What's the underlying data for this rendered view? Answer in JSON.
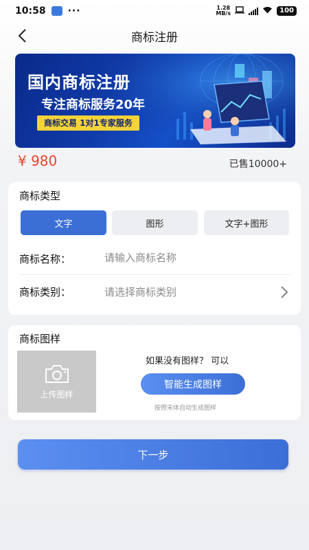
{
  "status_bar": {
    "time": "10:58",
    "more": "···",
    "net_speed_value": "1.28",
    "net_speed_unit": "MB/s",
    "battery": "100"
  },
  "nav": {
    "title": "商标注册"
  },
  "banner": {
    "title": "国内商标注册",
    "subtitle": "专注商标服务20年",
    "tag": "商标交易  1对1专家服务"
  },
  "price": {
    "amount": "¥ 980",
    "sold": "已售10000+"
  },
  "trademark_type": {
    "title": "商标类型",
    "options": [
      "文字",
      "图形",
      "文字+图形"
    ],
    "selected": "文字"
  },
  "form": {
    "name_label": "商标名称：",
    "name_placeholder": "请输入商标名称",
    "category_label": "商标类别：",
    "category_placeholder": "请选择商标类别"
  },
  "design": {
    "title": "商标图样",
    "upload_label": "上传图样",
    "hint": "如果没有图样？ 可以",
    "generate_label": "智能生成图样",
    "note": "按照宋体自动生成图样"
  },
  "footer": {
    "next_label": "下一步"
  },
  "colors": {
    "accent": "#3b6fd6",
    "price": "#e5462d",
    "banner_tag": "#f7d33a"
  }
}
